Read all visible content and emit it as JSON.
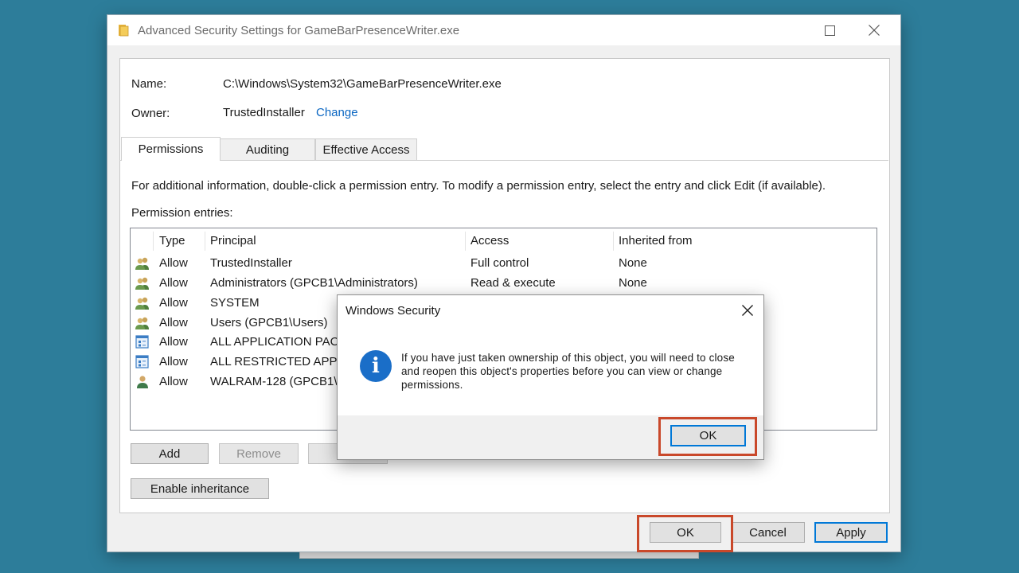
{
  "window": {
    "title": "Advanced Security Settings for GameBarPresenceWriter.exe",
    "icons": {
      "title": "folder-icon",
      "minimize": "minimize-icon",
      "maximize": "maximize-icon",
      "close": "close-icon"
    }
  },
  "object": {
    "name_label": "Name:",
    "name_value": "C:\\Windows\\System32\\GameBarPresenceWriter.exe",
    "owner_label": "Owner:",
    "owner_value": "TrustedInstaller",
    "change_link": "Change"
  },
  "tabs": [
    {
      "label": "Permissions",
      "active": true
    },
    {
      "label": "Auditing",
      "active": false
    },
    {
      "label": "Effective Access",
      "active": false
    }
  ],
  "permissions": {
    "info_text": "For additional information, double-click a permission entry. To modify a permission entry, select the entry and click Edit (if available).",
    "entries_label": "Permission entries:",
    "columns": [
      "Type",
      "Principal",
      "Access",
      "Inherited from"
    ],
    "rows": [
      {
        "icon": "group-users-icon",
        "type": "Allow",
        "principal": "TrustedInstaller",
        "access": "Full control",
        "inherited": "None"
      },
      {
        "icon": "group-users-icon",
        "type": "Allow",
        "principal": "Administrators (GPCB1\\Administrators)",
        "access": "Read & execute",
        "inherited": "None"
      },
      {
        "icon": "group-users-icon",
        "type": "Allow",
        "principal": "SYSTEM",
        "access": "",
        "inherited": ""
      },
      {
        "icon": "group-users-icon",
        "type": "Allow",
        "principal": "Users (GPCB1\\Users)",
        "access": "",
        "inherited": ""
      },
      {
        "icon": "app-package-icon",
        "type": "Allow",
        "principal": "ALL APPLICATION PAC",
        "access": "",
        "inherited": ""
      },
      {
        "icon": "app-package-icon",
        "type": "Allow",
        "principal": "ALL RESTRICTED APPLI",
        "access": "",
        "inherited": ""
      },
      {
        "icon": "user-icon",
        "type": "Allow",
        "principal": "WALRAM-128 (GPCB1\\",
        "access": "",
        "inherited": ""
      }
    ]
  },
  "buttons": {
    "add": "Add",
    "remove": "Remove",
    "enable_inheritance": "Enable inheritance",
    "ok": "OK",
    "cancel": "Cancel",
    "apply": "Apply"
  },
  "dialog": {
    "title": "Windows Security",
    "message": "If you have just taken ownership of this object, you will need to close and reopen this object's properties before you can view or change permissions.",
    "ok": "OK",
    "icons": {
      "info": "info-icon",
      "close": "close-icon"
    }
  },
  "colors": {
    "background": "#2d7d9a",
    "link": "#0a66c2",
    "highlight": "#c9482a",
    "info_icon": "#1a6ec8",
    "default_button_border": "#0078d7"
  }
}
